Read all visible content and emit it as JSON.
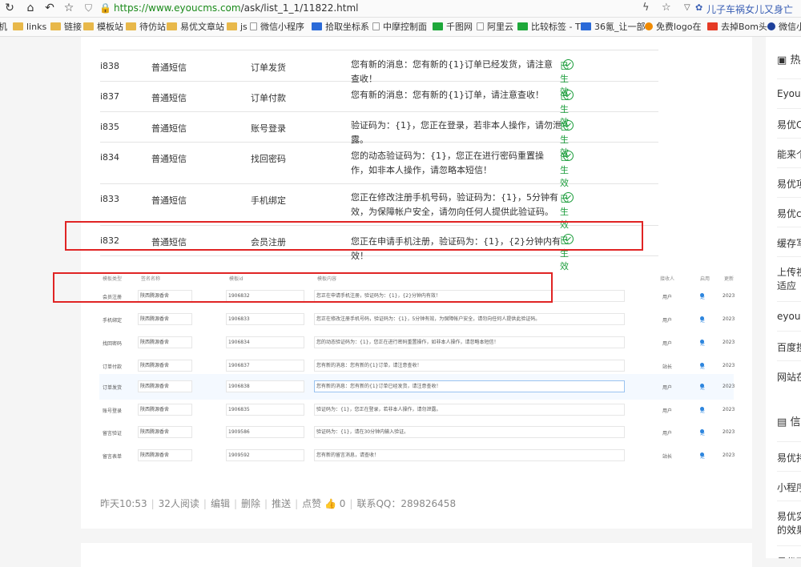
{
  "browser": {
    "url_host": "https://www.eyoucms.com",
    "url_path": "/ask/list_1_1/11822.html",
    "search_text": "儿子车祸女儿又身亡"
  },
  "bookmarks": [
    {
      "label": "机",
      "icon": "folder-icon"
    },
    {
      "label": "links",
      "icon": "folder-icon"
    },
    {
      "label": "链接",
      "icon": "folder-icon"
    },
    {
      "label": "模板站",
      "icon": "folder-icon"
    },
    {
      "label": "待仿站",
      "icon": "folder-icon"
    },
    {
      "label": "易优文章站",
      "icon": "folder-icon"
    },
    {
      "label": "js",
      "icon": "folder-icon"
    },
    {
      "label": "微信小程序",
      "icon": "page-icon"
    },
    {
      "label": "拾取坐标系",
      "icon": "paw-icon"
    },
    {
      "label": "中摩控制面",
      "icon": "page-icon"
    },
    {
      "label": "千图网",
      "icon": "qiantu-icon"
    },
    {
      "label": "阿里云",
      "icon": "page-icon"
    },
    {
      "label": "比较标签 - T",
      "icon": "leaf-icon"
    },
    {
      "label": "36氪_让一部",
      "icon": "kr-icon"
    },
    {
      "label": "免费logo在",
      "icon": "sun-icon"
    },
    {
      "label": "去掉Bom头",
      "icon": "c-icon"
    },
    {
      "label": "微信小",
      "icon": "wechat-icon"
    }
  ],
  "table1": {
    "rows": [
      {
        "id": "i838",
        "type": "普通短信",
        "scene": "订单发货",
        "content": "您有新的消息：您有新的{1}订单已经发货，请注意查收！",
        "status": "已生效"
      },
      {
        "id": "i837",
        "type": "普通短信",
        "scene": "订单付款",
        "content": "您有新的消息：您有新的{1}订单，请注意查收！",
        "status": "已生效"
      },
      {
        "id": "i835",
        "type": "普通短信",
        "scene": "账号登录",
        "content": "验证码为：{1}，您正在登录，若非本人操作，请勿泄露。",
        "status": "已生效"
      },
      {
        "id": "i834",
        "type": "普通短信",
        "scene": "找回密码",
        "content": "您的动态验证码为：{1}，您正在进行密码重置操作，如非本人操作，请忽略本短信！",
        "status": "已生效"
      },
      {
        "id": "i833",
        "type": "普通短信",
        "scene": "手机绑定",
        "content": "您正在修改注册手机号码，验证码为：{1}，5分钟有效，为保障帐户安全，请勿向任何人提供此验证码。",
        "status": "已生效"
      },
      {
        "id": "i832",
        "type": "普通短信",
        "scene": "会员注册",
        "content": "您正在申请手机注册，验证码为：{1}，{2}分钟内有效！",
        "status": "已生效"
      }
    ]
  },
  "table2": {
    "headers": [
      "模板类型",
      "签名名称",
      "模板id",
      "模板内容",
      "接收人",
      "启用",
      "更新"
    ],
    "rows": [
      {
        "type": "会员注册",
        "sign": "陕西腾源香舍",
        "tid": "1906832",
        "content": "您正在申请手机注册，验证码为：{1}，{2}分钟内有效！",
        "receiver": "用户",
        "enabled": "是",
        "date": "2023"
      },
      {
        "type": "手机绑定",
        "sign": "陕西腾源香舍",
        "tid": "1906833",
        "content": "您正在修改注册手机号码，验证码为：{1}，5分钟有效，为保障帐户安全，请勿向任何人提供此验证码。",
        "receiver": "用户",
        "enabled": "是",
        "date": "2023"
      },
      {
        "type": "找回密码",
        "sign": "陕西腾源香舍",
        "tid": "1906834",
        "content": "您的动态验证码为：{1}，您正在进行密码重置操作，如非本人操作，请忽略本短信！",
        "receiver": "用户",
        "enabled": "是",
        "date": "2023"
      },
      {
        "type": "订单付款",
        "sign": "陕西腾源香舍",
        "tid": "1906837",
        "content": "您有新的消息：您有新的{1}订单，请注意查收！",
        "receiver": "站长",
        "enabled": "是",
        "date": "2023"
      },
      {
        "type": "订单发货",
        "sign": "陕西腾源香舍",
        "tid": "1906838",
        "content": "您有新的消息：您有新的{1}订单已经发货，请注意查收！",
        "receiver": "用户",
        "enabled": "是",
        "date": "2023"
      },
      {
        "type": "账号登录",
        "sign": "陕西腾源香舍",
        "tid": "1906835",
        "content": "验证码为：{1}，您正在登录，若非本人操作，请勿泄露。",
        "receiver": "用户",
        "enabled": "是",
        "date": "2023"
      },
      {
        "type": "留言验证",
        "sign": "陕西腾源香舍",
        "tid": "1909586",
        "content": "验证码为：{1}，请在30分钟内输入验证。",
        "receiver": "用户",
        "enabled": "是",
        "date": "2023"
      },
      {
        "type": "留言表单",
        "sign": "陕西腾源香舍",
        "tid": "1909592",
        "content": "您有新的留言消息，请查收！",
        "receiver": "站长",
        "enabled": "是",
        "date": "2023"
      }
    ]
  },
  "meta": {
    "time": "昨天10:53",
    "views": "32人阅读",
    "edit": "编辑",
    "delete": "删除",
    "push": "推送",
    "like_label": "点赞",
    "like_count": "0",
    "qq": "联系QQ：289826458"
  },
  "sidebar": {
    "section1_title": "热",
    "section1_items": [
      "EyouC",
      "易优C",
      "能来个",
      "易优项",
      "易优c",
      "缓存写",
      "上传视\n适应",
      "eyouc",
      "百度搜",
      "网站在"
    ],
    "section2_title": "信",
    "section2_items": [
      "易优持",
      "小程序",
      "易优实\n的效果",
      "易优下"
    ]
  }
}
